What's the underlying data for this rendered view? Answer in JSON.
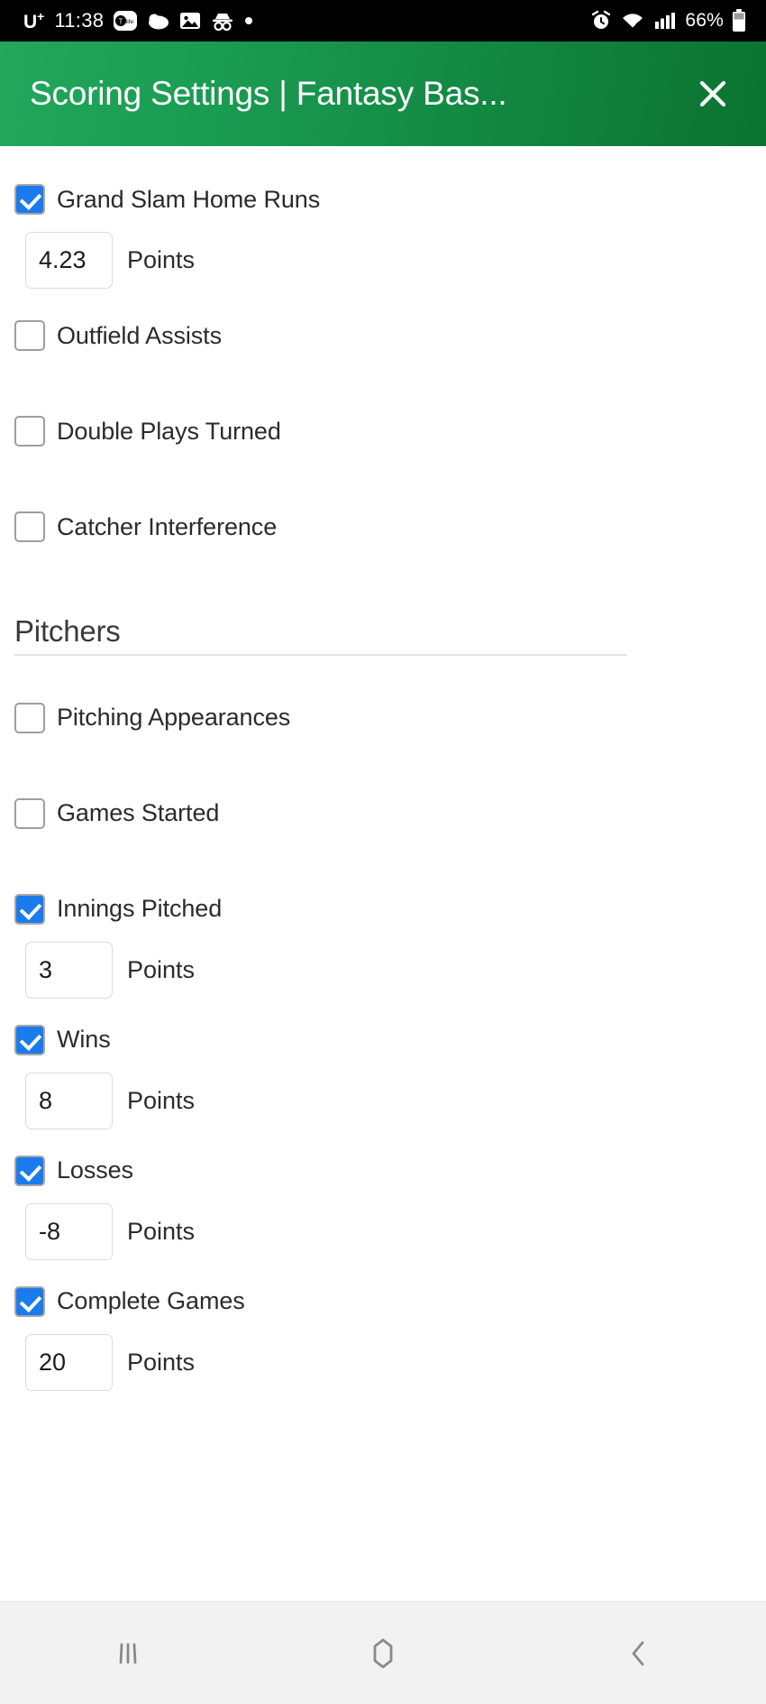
{
  "status_bar": {
    "carrier": "U",
    "carrier_sup": "+",
    "time": "11:38",
    "battery_percent": "66%",
    "left_icons": [
      "tmo-app-icon",
      "cloud-icon",
      "gallery-image-icon",
      "incognito-icon",
      "dot-icon"
    ],
    "right_icons": [
      "alarm-icon",
      "wifi-icon",
      "cellular-signal-icon",
      "battery-icon"
    ]
  },
  "app_bar": {
    "title": "Scoring Settings | Fantasy Bas...",
    "close_label": "✕",
    "gradient_start": "#22a75c",
    "gradient_end": "#0b7330"
  },
  "theme": {
    "checkbox_checked_color": "#1a7bee",
    "checkbox_border_color": "#9e9e9e",
    "input_border_color": "#dcdcdc",
    "text_color": "#2b2b2b",
    "nav_bar_bg": "#f2f2f2"
  },
  "points_unit_label": "Points",
  "settings": [
    {
      "label": "Grand Slam Home Runs",
      "checked": true,
      "points": "4.23"
    },
    {
      "label": "Outfield Assists",
      "checked": false,
      "points": null
    },
    {
      "label": "Double Plays Turned",
      "checked": false,
      "points": null
    },
    {
      "label": "Catcher Interference",
      "checked": false,
      "points": null
    }
  ],
  "section": {
    "title": "Pitchers"
  },
  "pitcher_settings": [
    {
      "label": "Pitching Appearances",
      "checked": false,
      "points": null
    },
    {
      "label": "Games Started",
      "checked": false,
      "points": null
    },
    {
      "label": "Innings Pitched",
      "checked": true,
      "points": "3"
    },
    {
      "label": "Wins",
      "checked": true,
      "points": "8"
    },
    {
      "label": "Losses",
      "checked": true,
      "points": "-8"
    },
    {
      "label": "Complete Games",
      "checked": true,
      "points": "20"
    }
  ],
  "nav_bar": {
    "recents_label": "recents-icon",
    "home_label": "home-icon",
    "back_label": "back-icon"
  }
}
